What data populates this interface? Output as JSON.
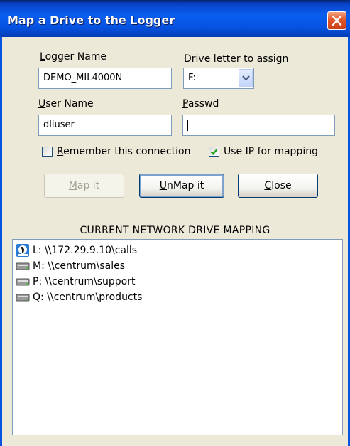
{
  "window": {
    "title": "Map a Drive to the Logger",
    "close_icon": "close-icon"
  },
  "form": {
    "logger_name": {
      "label_hotkey": "L",
      "label_rest": "ogger Name",
      "value": "DEMO_MIL4000N"
    },
    "drive_letter": {
      "label_hotkey": "D",
      "label_rest": "rive letter to assign",
      "value": "F:"
    },
    "user_name": {
      "label_hotkey": "U",
      "label_rest": "ser Name",
      "value": "dliuser"
    },
    "password": {
      "label_hotkey": "P",
      "label_rest": "asswd",
      "value": ""
    },
    "remember": {
      "label_hotkey": "R",
      "label_rest": "emember this connection",
      "checked": false
    },
    "use_ip": {
      "label": "Use IP for mapping",
      "checked": true
    }
  },
  "buttons": {
    "map": {
      "hotkey": "M",
      "rest": "ap it",
      "enabled": false
    },
    "unmap": {
      "hotkey": "U",
      "rest": "nMap it",
      "enabled": true
    },
    "close": {
      "hotkey": "C",
      "rest": "lose",
      "enabled": true
    }
  },
  "mapping": {
    "title": "CURRENT NETWORK DRIVE MAPPING",
    "items": [
      {
        "text": "L: \\\\172.29.9.10\\calls",
        "icon": "logger-drive-icon"
      },
      {
        "text": "M: \\\\centrum\\sales",
        "icon": "network-drive-icon"
      },
      {
        "text": "P: \\\\centrum\\support",
        "icon": "network-drive-icon"
      },
      {
        "text": "Q: \\\\centrum\\products",
        "icon": "network-drive-icon"
      }
    ]
  },
  "colors": {
    "titlebar": "#0a5ef0",
    "dialog_bg": "#ece9d8",
    "close_button": "#e2582c",
    "field_border": "#7f9db9",
    "checkmark": "#21a121"
  }
}
